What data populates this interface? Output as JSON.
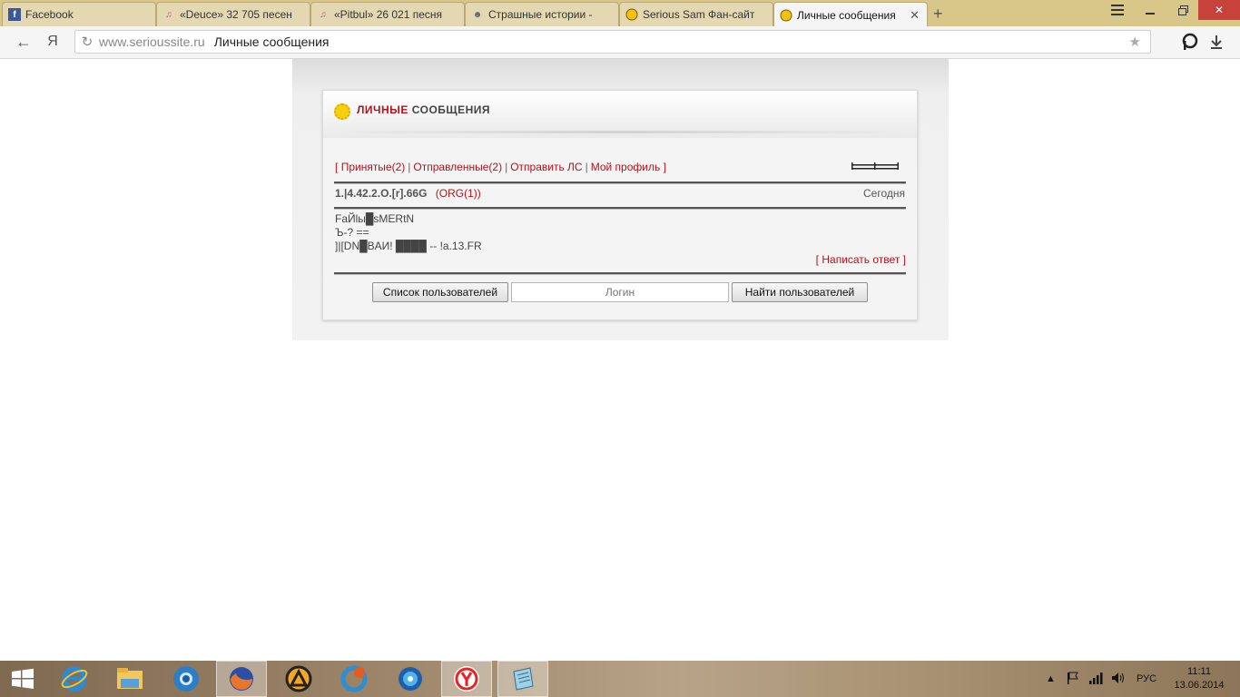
{
  "browser": {
    "tabs": [
      {
        "label": "Facebook",
        "icon": "facebook-icon",
        "active": false
      },
      {
        "label": "«Deuce» 32 705 песен",
        "icon": "music-icon",
        "active": false
      },
      {
        "label": "«Pitbul» 26 021 песня",
        "icon": "music-icon",
        "active": false
      },
      {
        "label": "Страшные истории -",
        "icon": "site-icon",
        "active": false
      },
      {
        "label": "Serious Sam Фан-сайт",
        "icon": "serious-sam-icon",
        "active": false
      },
      {
        "label": "Личные сообщения",
        "icon": "serious-sam-icon",
        "active": true
      }
    ],
    "address": {
      "domain": "www.serioussite.ru",
      "page_title": "Личные сообщения"
    },
    "yandex_glyph": "Я"
  },
  "panel": {
    "title_red": "ЛИЧНЫЕ",
    "title_dark": "СООБЩЕНИЯ",
    "nav": {
      "open_bracket": "[",
      "received": "Принятые(2)",
      "sent": "Отправленные(2)",
      "send": "Отправить ЛС",
      "profile": "Мой профиль",
      "close_bracket": "]",
      "separator": "|"
    },
    "message": {
      "sender": "1.|4.42.2.O.[r].66G",
      "org": "(ORG(1))",
      "date": "Сегодня",
      "body": "FaЙlы█sMERtN\nЪ-? ==\n]|[DN█BAИ! ████ -- !a.13.FR",
      "reply_open": "[",
      "reply_label": "Написать ответ",
      "reply_close": "]"
    },
    "users_list_button": "Список пользователей",
    "login_placeholder": "Логин",
    "find_users_button": "Найти пользователей"
  },
  "taskbar": {
    "apps": [
      "internet-explorer",
      "file-explorer",
      "chrome-like-browser",
      "firefox",
      "aimp",
      "ccleaner",
      "media-player",
      "yandex-browser",
      "notepad"
    ],
    "language": "РУС",
    "time": "11:11",
    "date": "13.06.2014"
  },
  "colors": {
    "accent": "#b5121b",
    "tab_bar": "#d9c78a"
  }
}
